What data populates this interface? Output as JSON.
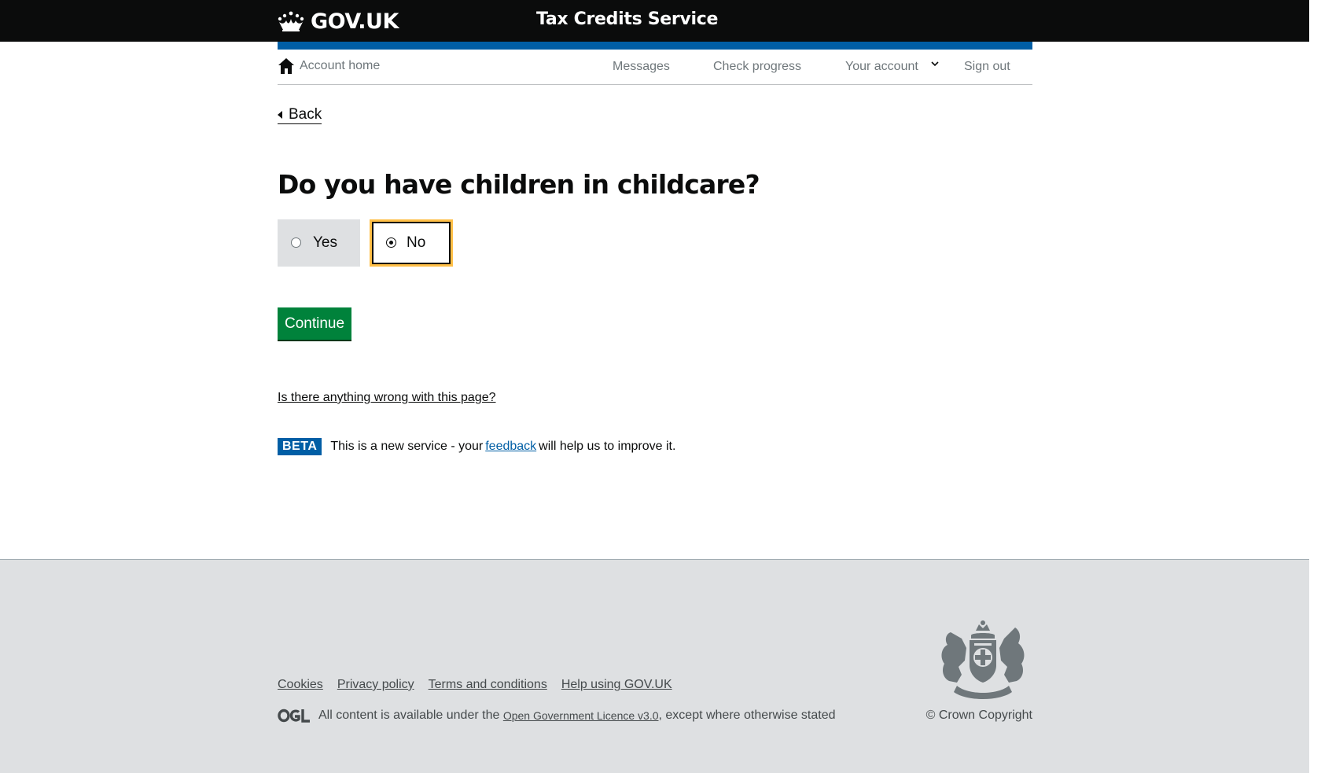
{
  "header": {
    "logo_text": "GOV.UK",
    "service_name": "Tax Credits Service",
    "logo_icon": "crown-icon"
  },
  "nav": {
    "home_label": "Account home",
    "home_icon": "home-icon",
    "messages": "Messages",
    "check_progress": "Check progress",
    "your_account": "Your account",
    "sign_out": "Sign out"
  },
  "back": {
    "label": "Back"
  },
  "question": {
    "title": "Do you have children in childcare?",
    "options": [
      {
        "label": "Yes",
        "selected": false
      },
      {
        "label": "No",
        "selected": true
      }
    ]
  },
  "continue_label": "Continue",
  "report_link": "Is there anything wrong with this page?",
  "beta": {
    "tag": "BETA",
    "text_before": "This is a new service  - your",
    "feedback_link": "feedback",
    "text_after": "will help us to improve it."
  },
  "footer": {
    "links": [
      "Cookies",
      "Privacy policy",
      "Terms and conditions",
      "Help using GOV.UK"
    ],
    "licence_before": "All content is available under the",
    "licence_link": "Open Government Licence v3.0",
    "licence_after": ", except where otherwise stated",
    "copyright": "© Crown Copyright"
  },
  "colors": {
    "header_bg": "#0b0c0c",
    "brand_blue": "#005ea5",
    "button_green": "#00823b",
    "focus_yellow": "#ffbf47",
    "footer_bg": "#dee0e2"
  }
}
